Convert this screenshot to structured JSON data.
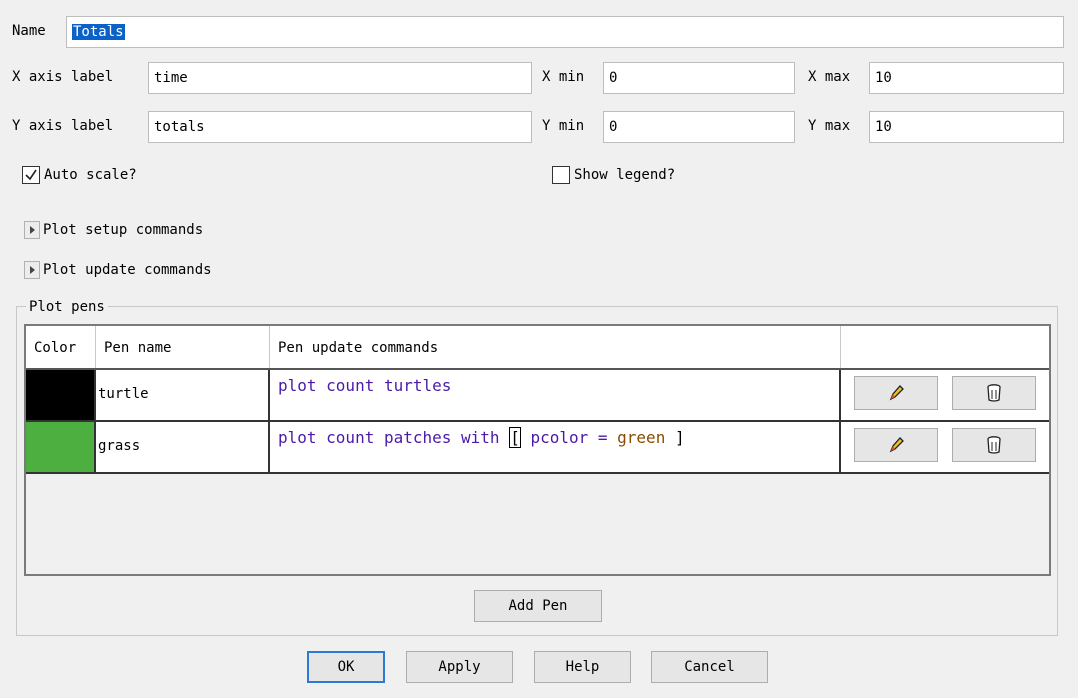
{
  "name": {
    "label": "Name",
    "value": "Totals"
  },
  "x_axis": {
    "label": "X axis label",
    "value": "time",
    "min_label": "X min",
    "min_value": "0",
    "max_label": "X max",
    "max_value": "10"
  },
  "y_axis": {
    "label": "Y axis label",
    "value": "totals",
    "min_label": "Y min",
    "min_value": "0",
    "max_label": "Y max",
    "max_value": "10"
  },
  "auto_scale": {
    "label": "Auto scale?",
    "checked": true
  },
  "show_legend": {
    "label": "Show legend?",
    "checked": false
  },
  "sections": {
    "setup": "Plot setup commands",
    "update": "Plot update commands"
  },
  "pens": {
    "title": "Plot pens",
    "headers": {
      "color": "Color",
      "name": "Pen name",
      "commands": "Pen update commands"
    },
    "rows": [
      {
        "color": "#000000",
        "name": "turtle"
      },
      {
        "color": "#4caf3f",
        "name": "grass"
      }
    ],
    "add_label": "Add Pen",
    "edit_icon": "pencil-icon",
    "delete_icon": "trash-can-icon"
  },
  "buttons": {
    "ok": "OK",
    "apply": "Apply",
    "help": "Help",
    "cancel": "Cancel"
  }
}
